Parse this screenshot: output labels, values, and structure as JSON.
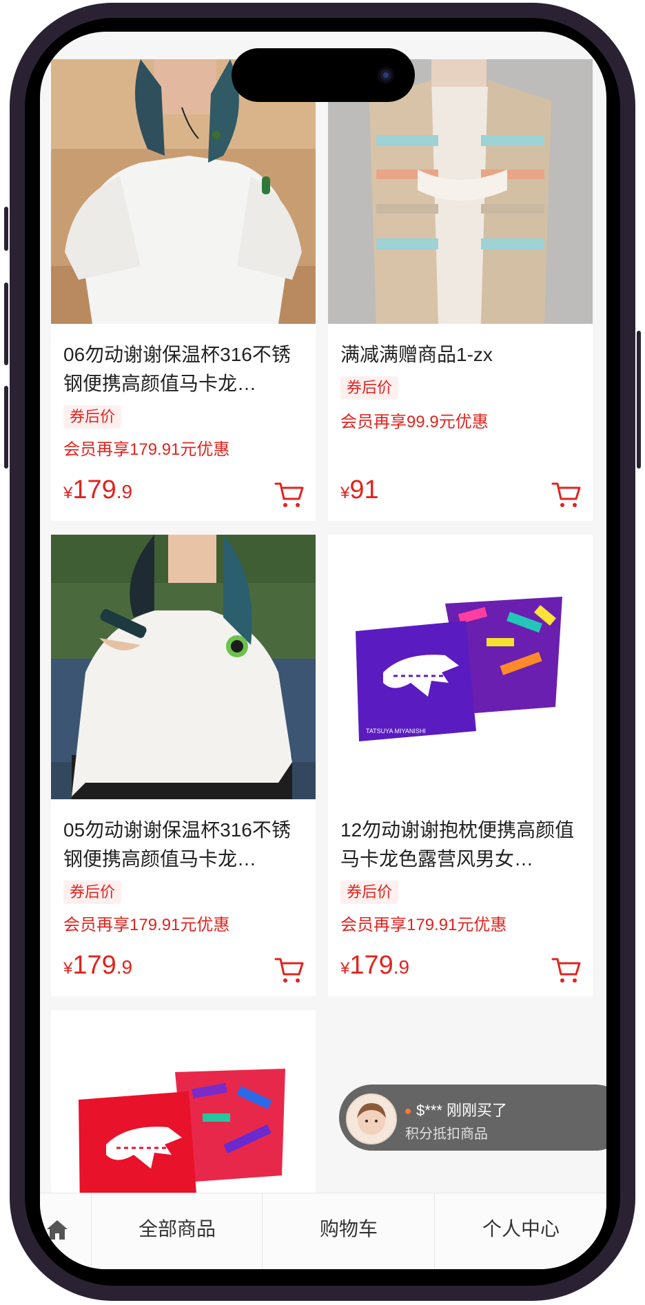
{
  "products": [
    {
      "title": "06勿动谢谢保温杯316不锈钢便携高颜值马卡龙…",
      "tag": "券后价",
      "promo": "会员再享179.91元优惠",
      "currency": "¥",
      "price_int": "179",
      "price_dec": ".9",
      "image": "woman-white-tshirt-photo"
    },
    {
      "title": "满减满赠商品1-zx",
      "tag": "券后价",
      "promo": "会员再享99.9元优惠",
      "currency": "¥",
      "price_int": "91",
      "price_dec": "",
      "image": "striped-knit-coat-photo"
    },
    {
      "title": "05勿动谢谢保温杯316不锈钢便携高颜值马卡龙…",
      "tag": "券后价",
      "promo": "会员再享179.91元优惠",
      "currency": "¥",
      "price_int": "179",
      "price_dec": ".9",
      "image": "woman-phone-sofa-photo"
    },
    {
      "title": "12勿动谢谢抱枕便携高颜值马卡龙色露营风男女…",
      "tag": "券后价",
      "promo": "会员再享179.91元优惠",
      "currency": "¥",
      "price_int": "179",
      "price_dec": ".9",
      "image": "purple-pillows-photo"
    },
    {
      "image": "red-pillows-photo"
    }
  ],
  "pillow_brand": "TATSUYA MIYANISHI",
  "toast": {
    "line1": "$*** 刚刚买了",
    "line2": "积分抵扣商品",
    "chevron": "›"
  },
  "tabbar": {
    "home_icon": "home-icon",
    "tabs": [
      "全部商品",
      "购物车",
      "个人中心"
    ]
  },
  "colors": {
    "accent": "#e0231e",
    "tag_bg": "#fff0f0",
    "phone_frame": "#2a2233"
  }
}
